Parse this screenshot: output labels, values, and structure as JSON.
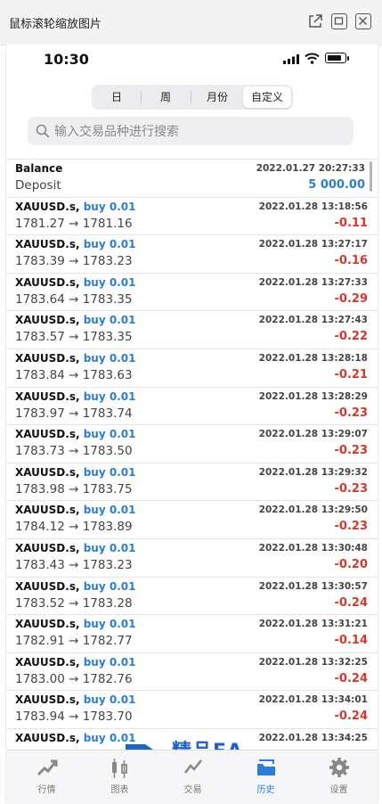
{
  "window": {
    "title": "鼠标滚轮缩放图片",
    "controls": [
      "external-link-icon",
      "maximize-icon",
      "close-icon"
    ]
  },
  "status_bar": {
    "time": "10:30"
  },
  "segment": {
    "tabs": [
      "日",
      "周",
      "月份",
      "自定义"
    ],
    "active": "自定义"
  },
  "search": {
    "placeholder": "输入交易品种进行搜索",
    "value": ""
  },
  "balance_entry": {
    "label": "Balance",
    "sub": "Deposit",
    "timestamp": "2022.01.27 20:27:33",
    "amount": "5 000.00"
  },
  "trades": [
    {
      "symbol": "XAUUSD.s,",
      "type": "buy 0.01",
      "prices": "1781.27 → 1781.16",
      "time": "2022.01.28 13:18:56",
      "profit": "-0.11"
    },
    {
      "symbol": "XAUUSD.s,",
      "type": "buy 0.01",
      "prices": "1783.39 → 1783.23",
      "time": "2022.01.28 13:27:17",
      "profit": "-0.16"
    },
    {
      "symbol": "XAUUSD.s,",
      "type": "buy 0.01",
      "prices": "1783.64 → 1783.35",
      "time": "2022.01.28 13:27:33",
      "profit": "-0.29"
    },
    {
      "symbol": "XAUUSD.s,",
      "type": "buy 0.01",
      "prices": "1783.57 → 1783.35",
      "time": "2022.01.28 13:27:43",
      "profit": "-0.22"
    },
    {
      "symbol": "XAUUSD.s,",
      "type": "buy 0.01",
      "prices": "1783.84 → 1783.63",
      "time": "2022.01.28 13:28:18",
      "profit": "-0.21"
    },
    {
      "symbol": "XAUUSD.s,",
      "type": "buy 0.01",
      "prices": "1783.97 → 1783.74",
      "time": "2022.01.28 13:28:29",
      "profit": "-0.23"
    },
    {
      "symbol": "XAUUSD.s,",
      "type": "buy 0.01",
      "prices": "1783.73 → 1783.50",
      "time": "2022.01.28 13:29:07",
      "profit": "-0.23"
    },
    {
      "symbol": "XAUUSD.s,",
      "type": "buy 0.01",
      "prices": "1783.98 → 1783.75",
      "time": "2022.01.28 13:29:32",
      "profit": "-0.23"
    },
    {
      "symbol": "XAUUSD.s,",
      "type": "buy 0.01",
      "prices": "1784.12 → 1783.89",
      "time": "2022.01.28 13:29:50",
      "profit": "-0.23"
    },
    {
      "symbol": "XAUUSD.s,",
      "type": "buy 0.01",
      "prices": "1783.43 → 1783.23",
      "time": "2022.01.28 13:30:48",
      "profit": "-0.20"
    },
    {
      "symbol": "XAUUSD.s,",
      "type": "buy 0.01",
      "prices": "1783.52 → 1783.28",
      "time": "2022.01.28 13:30:57",
      "profit": "-0.24"
    },
    {
      "symbol": "XAUUSD.s,",
      "type": "buy 0.01",
      "prices": "1782.91 → 1782.77",
      "time": "2022.01.28 13:31:21",
      "profit": "-0.14"
    },
    {
      "symbol": "XAUUSD.s,",
      "type": "buy 0.01",
      "prices": "1783.00 → 1782.76",
      "time": "2022.01.28 13:32:25",
      "profit": "-0.24"
    },
    {
      "symbol": "XAUUSD.s,",
      "type": "buy 0.01",
      "prices": "1783.94 → 1783.70",
      "time": "2022.01.28 13:34:01",
      "profit": "-0.24"
    },
    {
      "symbol": "XAUUSD.s,",
      "type": "buy 0.01",
      "prices": "",
      "time": "2022.01.28 13:34:25",
      "profit": ""
    }
  ],
  "tab_bar": {
    "items": [
      {
        "label": "行情",
        "icon": "quotes-icon"
      },
      {
        "label": "图表",
        "icon": "chart-icon"
      },
      {
        "label": "交易",
        "icon": "trade-icon"
      },
      {
        "label": "历史",
        "icon": "history-icon"
      },
      {
        "label": "设置",
        "icon": "settings-icon"
      }
    ],
    "active": "历史"
  },
  "watermark": {
    "title": "精品EA",
    "url": "eaclubshare.com"
  },
  "colors": {
    "accent": "#2a7ed9",
    "loss": "#d8382c",
    "watermark": "#1d63c8"
  }
}
